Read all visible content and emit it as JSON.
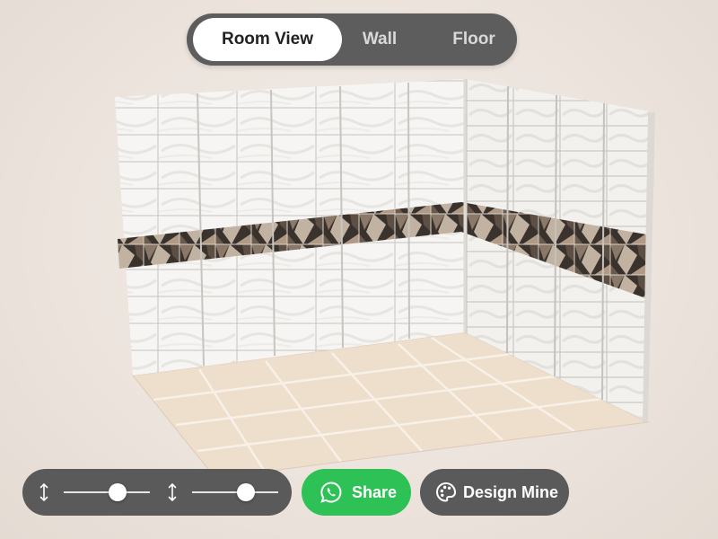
{
  "view_toggle": {
    "tabs": [
      {
        "label": "Room View",
        "active": true
      },
      {
        "label": "Wall",
        "active": false
      },
      {
        "label": "Floor",
        "active": false
      }
    ]
  },
  "room": {
    "wall_tile_color": "#f6f5f3",
    "wall_grout_color": "#c9c7c3",
    "border_colors": [
      "#3a322c",
      "#8a7868",
      "#c2b2a2",
      "#5e4f44"
    ],
    "floor_tile_color": "#eedfcd",
    "floor_grout_color": "#f8f1e8"
  },
  "controls": {
    "slider_1": {
      "icon": "vertical-resize-icon",
      "value": 0.62
    },
    "slider_2": {
      "icon": "vertical-resize-icon",
      "value": 0.62
    },
    "share": {
      "label": "Share",
      "icon": "whatsapp-icon",
      "color": "#2dc156"
    },
    "design_mine": {
      "label": "Design Mine",
      "icon": "palette-icon"
    }
  }
}
